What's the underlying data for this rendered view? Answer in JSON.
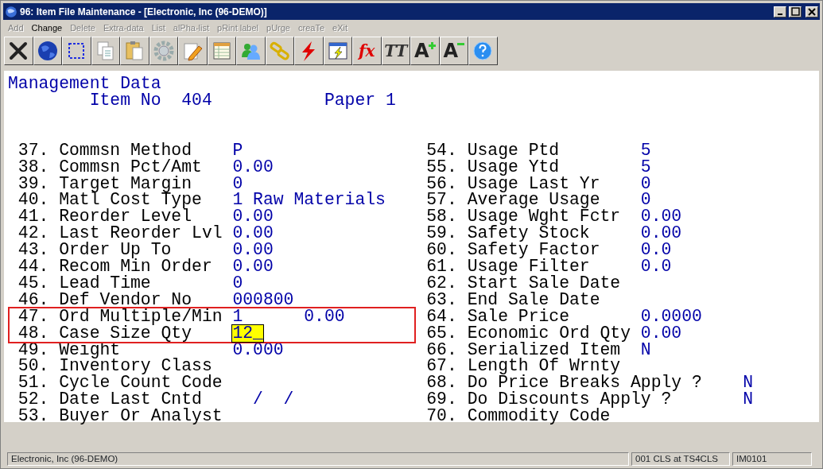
{
  "window": {
    "title": "96: Item File Maintenance - [Electronic, Inc (96-DEMO)]"
  },
  "menu": [
    {
      "label": "Add",
      "disabled": true
    },
    {
      "label": "Change",
      "disabled": false
    },
    {
      "label": "Delete",
      "disabled": true
    },
    {
      "label": "Extra-data",
      "disabled": true
    },
    {
      "label": "List",
      "disabled": true
    },
    {
      "label": "alPha-list",
      "disabled": true
    },
    {
      "label": "pRint label",
      "disabled": true
    },
    {
      "label": "pUrge",
      "disabled": true
    },
    {
      "label": "creaTe",
      "disabled": true
    },
    {
      "label": "eXit",
      "disabled": true
    }
  ],
  "toolbar": [
    {
      "kind": "close"
    },
    {
      "kind": "globe"
    },
    {
      "kind": "select"
    },
    {
      "kind": "copy"
    },
    {
      "kind": "paste"
    },
    {
      "kind": "gear"
    },
    {
      "kind": "edit"
    },
    {
      "kind": "table"
    },
    {
      "kind": "users"
    },
    {
      "kind": "link"
    },
    {
      "kind": "bolt"
    },
    {
      "kind": "window-bolt"
    },
    {
      "kind": "text",
      "glyph": "fx",
      "color": "#e00000"
    },
    {
      "kind": "text",
      "glyph": "TT",
      "color": "#333333"
    },
    {
      "kind": "font-up",
      "glyph": "A"
    },
    {
      "kind": "font-down",
      "glyph": "A"
    },
    {
      "kind": "help"
    }
  ],
  "screen": {
    "heading": "Management Data",
    "item_label": "Item No",
    "item_no": "404",
    "item_desc": "Paper 1",
    "left": [
      {
        "no": "37.",
        "label": "Commsn Method",
        "value": "P"
      },
      {
        "no": "38.",
        "label": "Commsn Pct/Amt",
        "value": "0.00"
      },
      {
        "no": "39.",
        "label": "Target Margin",
        "value": "0"
      },
      {
        "no": "40.",
        "label": "Matl Cost Type",
        "value": "1 Raw Materials"
      },
      {
        "no": "41.",
        "label": "Reorder Level",
        "value": "0.00"
      },
      {
        "no": "42.",
        "label": "Last Reorder Lvl",
        "value": "0.00"
      },
      {
        "no": "43.",
        "label": "Order Up To",
        "value": "0.00"
      },
      {
        "no": "44.",
        "label": "Recom Min Order",
        "value": "0.00"
      },
      {
        "no": "45.",
        "label": "Lead Time",
        "value": "0"
      },
      {
        "no": "46.",
        "label": "Def Vendor No",
        "value": "000800"
      },
      {
        "no": "47.",
        "label": "Ord Multiple/Min",
        "value": "1",
        "value_2": "0.00",
        "highlighted": true
      },
      {
        "no": "48.",
        "label": "Case Size Qty",
        "value": "12_",
        "highlighted": true,
        "focused": true
      },
      {
        "no": "49.",
        "label": "Weight",
        "value": "0.000"
      },
      {
        "no": "50.",
        "label": "Inventory Class"
      },
      {
        "no": "51.",
        "label": "Cycle Count Code"
      },
      {
        "no": "52.",
        "label": "Date Last Cntd",
        "value": "  /  /"
      },
      {
        "no": "53.",
        "label": "Buyer Or Analyst"
      }
    ],
    "right": [
      {
        "no": "54.",
        "label": "Usage Ptd",
        "value": "5"
      },
      {
        "no": "55.",
        "label": "Usage Ytd",
        "value": "5"
      },
      {
        "no": "56.",
        "label": "Usage Last Yr",
        "value": "0"
      },
      {
        "no": "57.",
        "label": "Average Usage",
        "value": "0"
      },
      {
        "no": "58.",
        "label": "Usage Wght Fctr",
        "value": "0.00"
      },
      {
        "no": "59.",
        "label": "Safety Stock",
        "value": "0.00"
      },
      {
        "no": "60.",
        "label": "Safety Factor",
        "value": "0.0"
      },
      {
        "no": "61.",
        "label": "Usage Filter",
        "value": "0.0"
      },
      {
        "no": "62.",
        "label": "Start Sale Date"
      },
      {
        "no": "63.",
        "label": "End Sale Date"
      },
      {
        "no": "64.",
        "label": "Sale Price",
        "value": "0.0000"
      },
      {
        "no": "65.",
        "label": "Economic Ord Qty",
        "value": "0.00"
      },
      {
        "no": "66.",
        "label": "Serialized Item",
        "value": "N"
      },
      {
        "no": "67.",
        "label": "Length Of Wrnty"
      },
      {
        "no": "68.",
        "label": "Do Price Breaks Apply ?",
        "value": "N",
        "kind": "question"
      },
      {
        "no": "69.",
        "label": "Do Discounts Apply ?",
        "value": "N",
        "kind": "question"
      },
      {
        "no": "70.",
        "label": "Commodity Code"
      }
    ]
  },
  "status_bar": [
    "Electronic, Inc (96-DEMO)",
    "001 CLS at TS4CLS",
    "IM0101"
  ]
}
